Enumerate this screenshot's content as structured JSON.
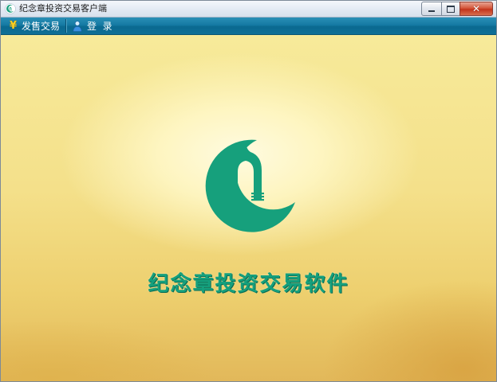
{
  "window": {
    "title": "纪念章投资交易客户端",
    "controls": {
      "minimize_icon": "minimize-icon",
      "maximize_icon": "maximize-icon",
      "close_icon": "close-icon",
      "close_glyph": "✕"
    }
  },
  "toolbar": {
    "items": [
      {
        "label": "发售交易",
        "icon": "yen-icon",
        "glyph": "¥"
      },
      {
        "label": "登  录",
        "icon": "user-icon"
      }
    ]
  },
  "main": {
    "app_name": "纪念章投资交易软件",
    "logo_icon": "crescent-arch-logo"
  },
  "colors": {
    "brand_green": "#15a07d",
    "toolbar_blue": "#157aa3",
    "background_gold": "#f4e08a",
    "close_red": "#c2341c"
  }
}
